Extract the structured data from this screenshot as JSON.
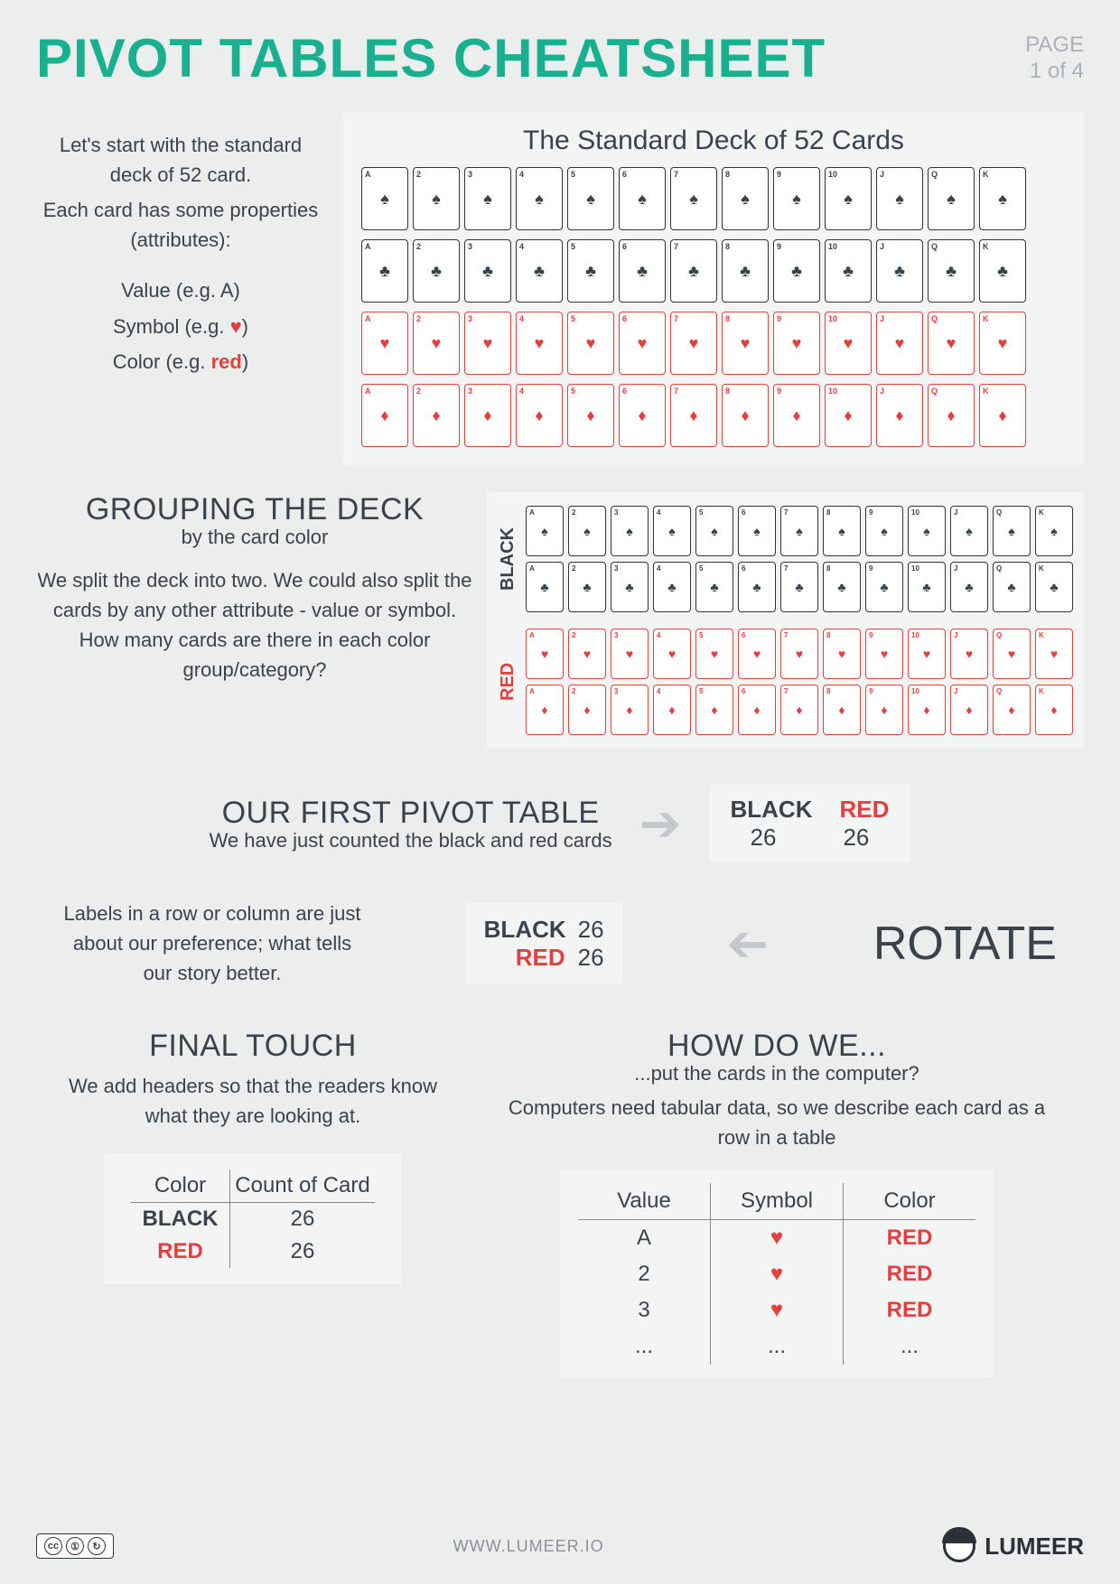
{
  "header": {
    "title": "PIVOT TABLES CHEATSHEET",
    "page_label": "PAGE",
    "page_num": "1 of 4"
  },
  "intro": {
    "line1": "Let's start with the standard deck of 52 card.",
    "line2": "Each card has some properties (attributes):",
    "attr_value": "Value (e.g. A)",
    "attr_symbol_prefix": "Symbol (e.g. ",
    "attr_symbol_glyph": "♥",
    "attr_symbol_suffix": ")",
    "attr_color_prefix": "Color (e.g. ",
    "attr_color_word": "red",
    "attr_color_suffix": ")",
    "deck_title": "The Standard Deck of 52 Cards",
    "suits": [
      "♠",
      "♣",
      "♥",
      "♦"
    ],
    "ranks": [
      "A",
      "2",
      "3",
      "4",
      "5",
      "6",
      "7",
      "8",
      "9",
      "10",
      "J",
      "Q",
      "K"
    ]
  },
  "grouping": {
    "title": "GROUPING THE DECK",
    "subtitle": "by the card color",
    "body": "We split the deck into two. We could also split the cards by any other attribute - value or symbol.\nHow many cards are there in each color group/category?",
    "label_black": "BLACK",
    "label_red": "RED"
  },
  "first_pivot": {
    "title": "OUR FIRST PIVOT TABLE",
    "subtitle": "We have just counted the black and red cards",
    "col_black": "BLACK",
    "col_red": "RED",
    "val_black": "26",
    "val_red": "26"
  },
  "rotate": {
    "body": "Labels in a row or column are just about our preference; what tells our story better.",
    "row_black": "BLACK",
    "row_red": "RED",
    "val_black": "26",
    "val_red": "26",
    "label": "ROTATE"
  },
  "final": {
    "title": "FINAL TOUCH",
    "body": "We add headers so that the readers know what they are looking at.",
    "hdr_color": "Color",
    "hdr_count": "Count of Card",
    "row1_label": "BLACK",
    "row1_val": "26",
    "row2_label": "RED",
    "row2_val": "26"
  },
  "howdo": {
    "title": "HOW DO WE...",
    "subtitle": "...put the cards in the computer?",
    "body": "Computers need tabular data, so we describe each card as a row in a table",
    "hdr_value": "Value",
    "hdr_symbol": "Symbol",
    "hdr_color": "Color",
    "rows": [
      {
        "value": "A",
        "symbol": "♥",
        "color": "RED"
      },
      {
        "value": "2",
        "symbol": "♥",
        "color": "RED"
      },
      {
        "value": "3",
        "symbol": "♥",
        "color": "RED"
      },
      {
        "value": "...",
        "symbol": "...",
        "color": "..."
      }
    ]
  },
  "footer": {
    "site": "WWW.LUMEER.IO",
    "brand": "LUMEER",
    "cc_by": "BY",
    "cc_sa": "SA"
  }
}
